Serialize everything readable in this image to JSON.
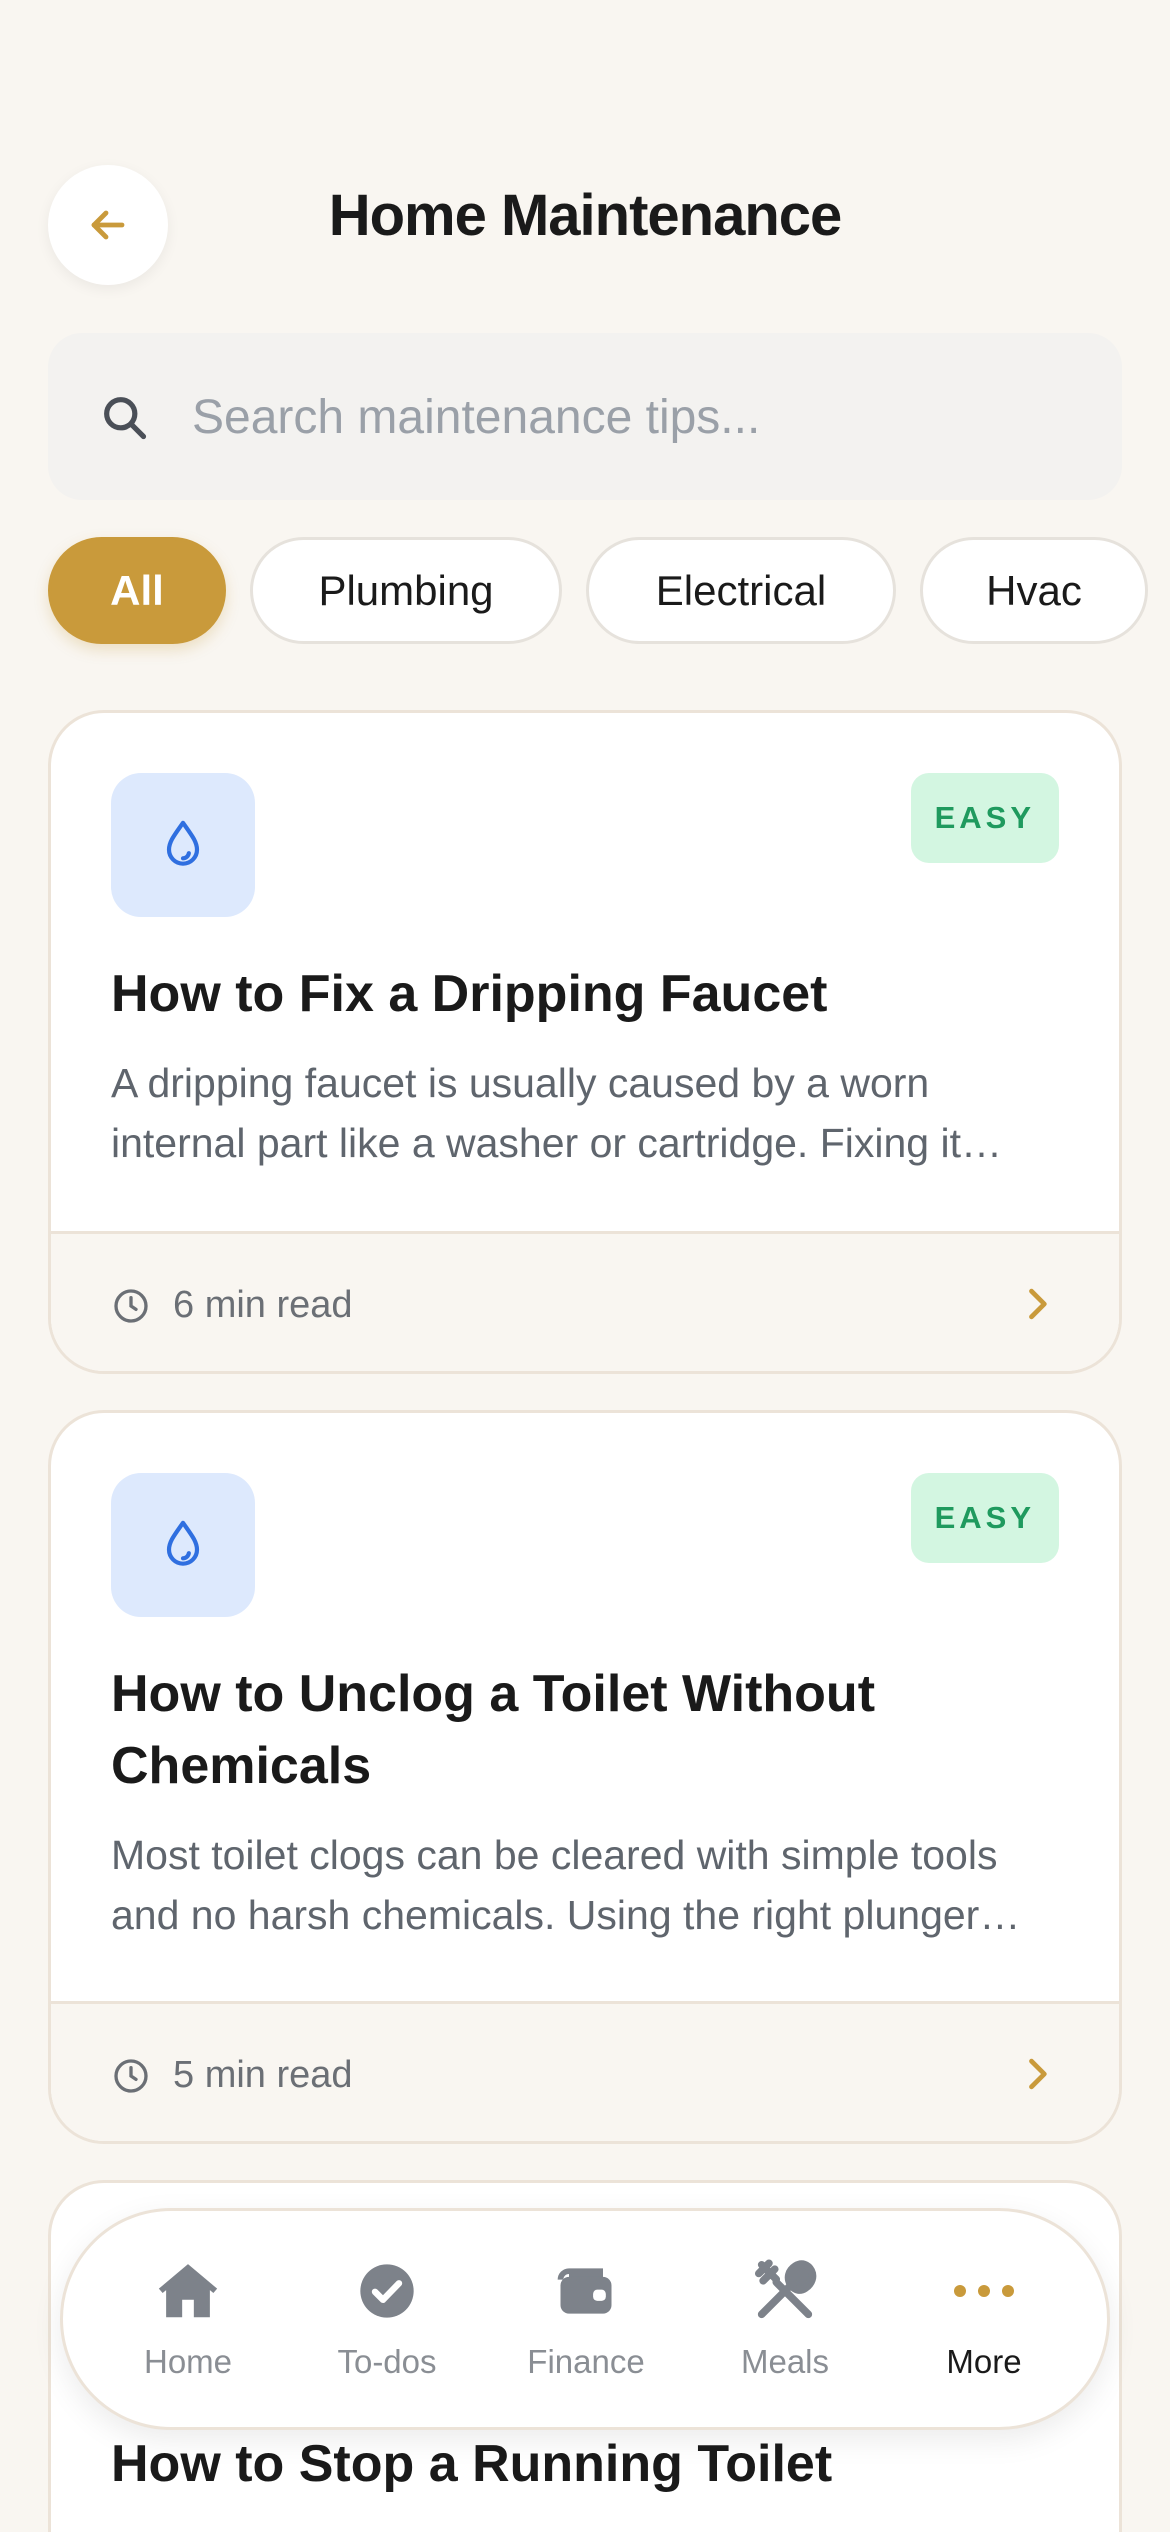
{
  "header": {
    "title": "Home Maintenance"
  },
  "search": {
    "placeholder": "Search maintenance tips..."
  },
  "filters": [
    "All",
    "Plumbing",
    "Electrical",
    "Hvac"
  ],
  "articles": [
    {
      "difficulty": "EASY",
      "icon": "water-drop-icon",
      "title": "How to Fix a Dripping Faucet",
      "excerpt": "A dripping faucet is usually caused by a worn internal part like a washer or cartridge. Fixing it yourself is usually a quick job.",
      "read_time": "6 min read"
    },
    {
      "difficulty": "EASY",
      "icon": "water-drop-icon",
      "title": "How to Unclog a Toilet Without Chemicals",
      "excerpt": "Most toilet clogs can be cleared with simple tools and no harsh chemicals. Using the right plunger makes all the difference.",
      "read_time": "5 min read"
    },
    {
      "title": "How to Stop a Running Toilet"
    }
  ],
  "nav": [
    {
      "label": "Home",
      "icon": "house-icon"
    },
    {
      "label": "To-dos",
      "icon": "check-circle-icon"
    },
    {
      "label": "Finance",
      "icon": "wallet-icon"
    },
    {
      "label": "Meals",
      "icon": "utensils-icon"
    },
    {
      "label": "More",
      "icon": "more-dots-icon"
    }
  ],
  "colors": {
    "accent": "#c99a3b",
    "background": "#f9f6f1",
    "badge_easy_bg": "#d3f6e1",
    "badge_easy_text": "#1f9a5e",
    "icon_bg": "#dde9fd",
    "icon_blue": "#2f6fe0"
  }
}
